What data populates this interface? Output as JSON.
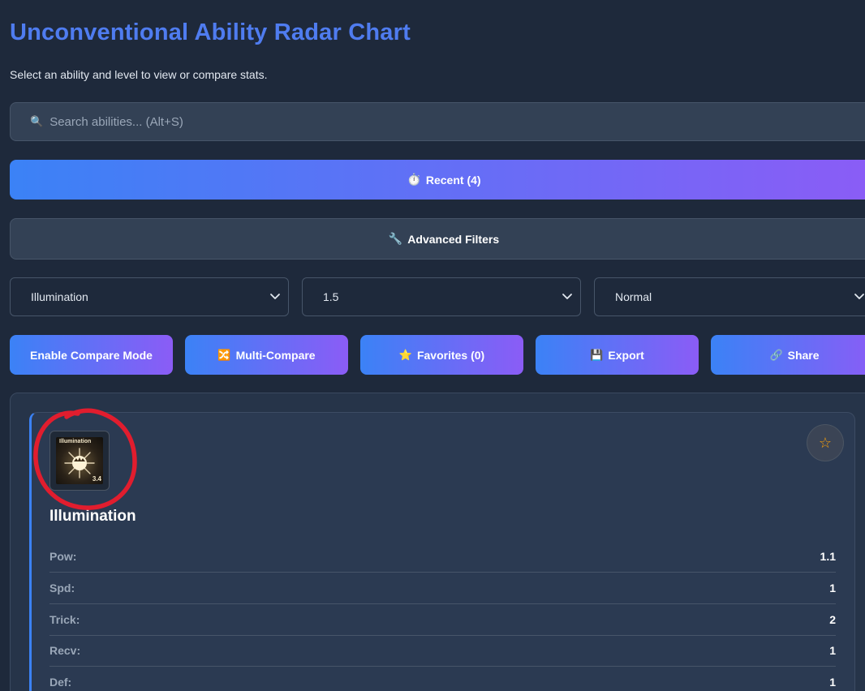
{
  "header": {
    "title": "Unconventional Ability Radar Chart",
    "subtitle": "Select an ability and level to view or compare stats."
  },
  "search": {
    "icon": "magnifier-icon",
    "placeholder": "Search abilities... (Alt+S)"
  },
  "recent": {
    "icon": "stopwatch-icon",
    "label": "Recent (4)"
  },
  "filters": {
    "icon": "wrench-icon",
    "label": "Advanced Filters"
  },
  "selects": {
    "ability": "Illumination",
    "level": "1.5",
    "mode": "Normal"
  },
  "actions": {
    "compare": "Enable Compare Mode",
    "multi_compare": "Multi-Compare",
    "favorites": "Favorites (0)",
    "export": "Export",
    "share": "Share",
    "icons": {
      "multi_compare": "shuffle-icon",
      "favorites": "star-icon",
      "export": "floppy-disk-icon",
      "share": "link-icon"
    }
  },
  "ability": {
    "name": "Illumination",
    "icon_caption": "Illumination",
    "icon_level": "3.4",
    "favorite_icon": "star-outline-icon",
    "stats": [
      {
        "label": "Pow:",
        "value": "1.1"
      },
      {
        "label": "Spd:",
        "value": "1"
      },
      {
        "label": "Trick:",
        "value": "2"
      },
      {
        "label": "Recv:",
        "value": "1"
      },
      {
        "label": "Def:",
        "value": "1"
      }
    ]
  },
  "colors": {
    "background": "#1e293b",
    "title": "#4f7cf0",
    "gradient_start": "#3b82f6",
    "gradient_end": "#8b5cf6",
    "favorite_star": "#f59e0b",
    "annotation": "#e11d2e"
  }
}
